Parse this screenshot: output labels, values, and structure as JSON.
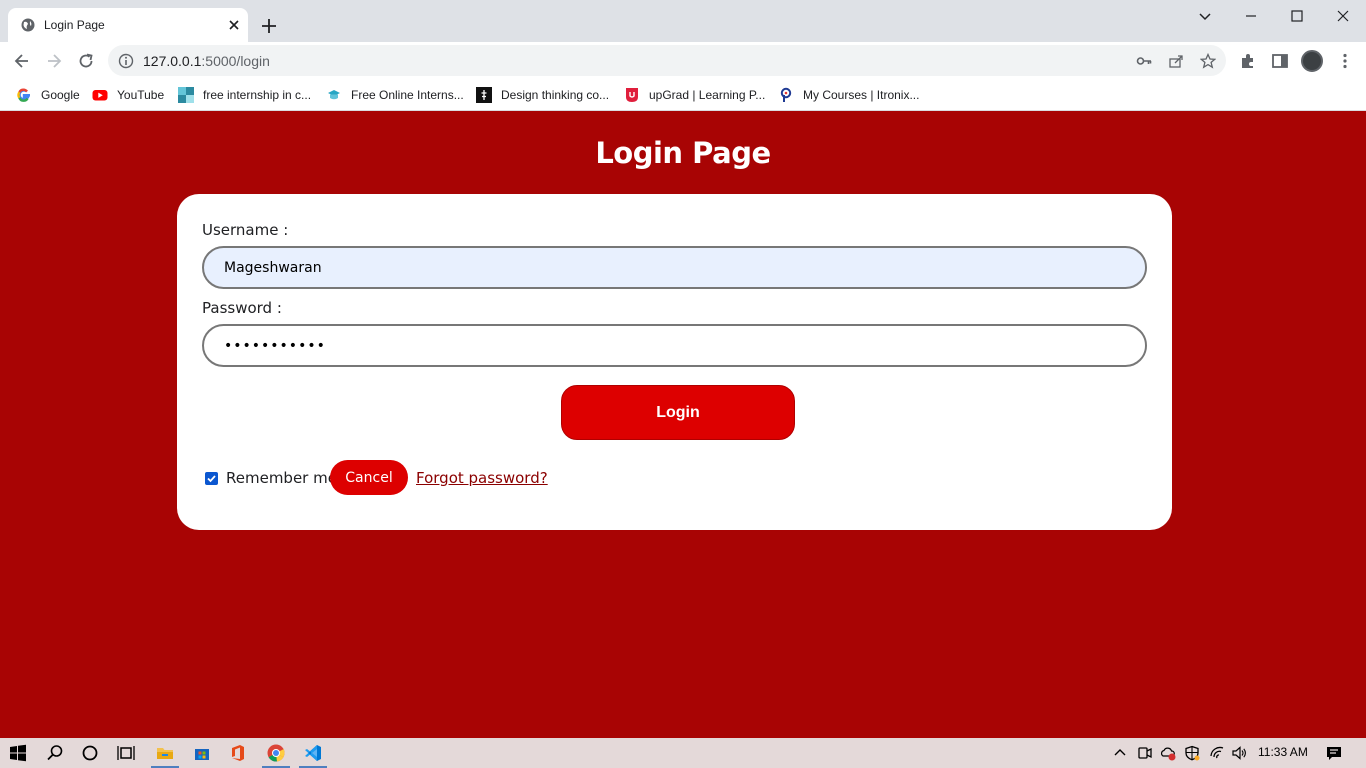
{
  "browser": {
    "tab": {
      "title": "Login Page"
    },
    "address": {
      "host": "127.0.0.1",
      "path": ":5000/login"
    },
    "bookmarks": [
      {
        "label": "Google",
        "icon": "google-icon"
      },
      {
        "label": "YouTube",
        "icon": "youtube-icon"
      },
      {
        "label": "free internship in c...",
        "icon": "internship-icon"
      },
      {
        "label": "Free Online Interns...",
        "icon": "online-internship-icon"
      },
      {
        "label": "Design thinking co...",
        "icon": "design-thinking-icon"
      },
      {
        "label": "upGrad | Learning P...",
        "icon": "upgrad-icon"
      },
      {
        "label": "My Courses | Itronix...",
        "icon": "itronix-icon"
      }
    ]
  },
  "page": {
    "title": "Login Page",
    "username_label": "Username :",
    "username_value": "Mageshwaran",
    "password_label": "Password :",
    "password_value": "•••••••••••",
    "login_label": "Login",
    "remember_label": "Remember me",
    "remember_checked": true,
    "cancel_label": "Cancel",
    "forgot_label": "Forgot password?"
  },
  "taskbar": {
    "time": "11:33 AM"
  },
  "colors": {
    "page_bg": "#a80404",
    "button": "#dd0000",
    "link": "#8b0000",
    "input_filled": "#e8f0fe"
  }
}
